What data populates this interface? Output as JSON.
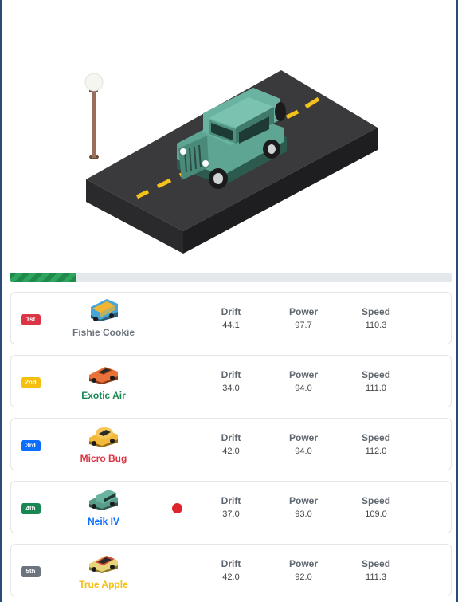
{
  "progress": {
    "value_percent": 15
  },
  "stat_labels": {
    "drift": "Drift",
    "power": "Power",
    "speed": "Speed"
  },
  "colors": {
    "progress": "#1f8a4c",
    "track": "#e4e8ec",
    "marker": "#e0242b"
  },
  "racers": [
    {
      "rank": "1st",
      "badge_color": "#dc3545",
      "name": "Fishie Cookie",
      "name_color": "#6c757d",
      "drift": "44.1",
      "power": "97.7",
      "speed": "110.3",
      "car_icon": "food-truck-icon",
      "body_color": "#45a6d8",
      "accent_color": "#f2b530",
      "marked": false
    },
    {
      "rank": "2nd",
      "badge_color": "#f5bf0f",
      "name": "Exotic Air",
      "name_color": "#198754",
      "drift": "34.0",
      "power": "94.0",
      "speed": "111.0",
      "car_icon": "sports-car-icon",
      "body_color": "#e8723a",
      "accent_color": "#c24f1c",
      "marked": false
    },
    {
      "rank": "3rd",
      "badge_color": "#0d6efd",
      "name": "Micro Bug",
      "name_color": "#dc3545",
      "drift": "42.0",
      "power": "94.0",
      "speed": "112.0",
      "car_icon": "beetle-car-icon",
      "body_color": "#f3b93a",
      "accent_color": "#d89a1e",
      "marked": false
    },
    {
      "rank": "4th",
      "badge_color": "#198754",
      "name": "Neik IV",
      "name_color": "#0d6efd",
      "drift": "37.0",
      "power": "93.0",
      "speed": "109.0",
      "car_icon": "jeep-icon",
      "body_color": "#5a9c8a",
      "accent_color": "#3f7a6a",
      "marked": true
    },
    {
      "rank": "5th",
      "badge_color": "#6c757d",
      "name": "True Apple",
      "name_color": "#f5bf0f",
      "drift": "42.0",
      "power": "92.0",
      "speed": "111.3",
      "car_icon": "hatchback-car-icon",
      "body_color": "#e8d47a",
      "accent_color": "#d04a3a",
      "marked": false
    }
  ]
}
